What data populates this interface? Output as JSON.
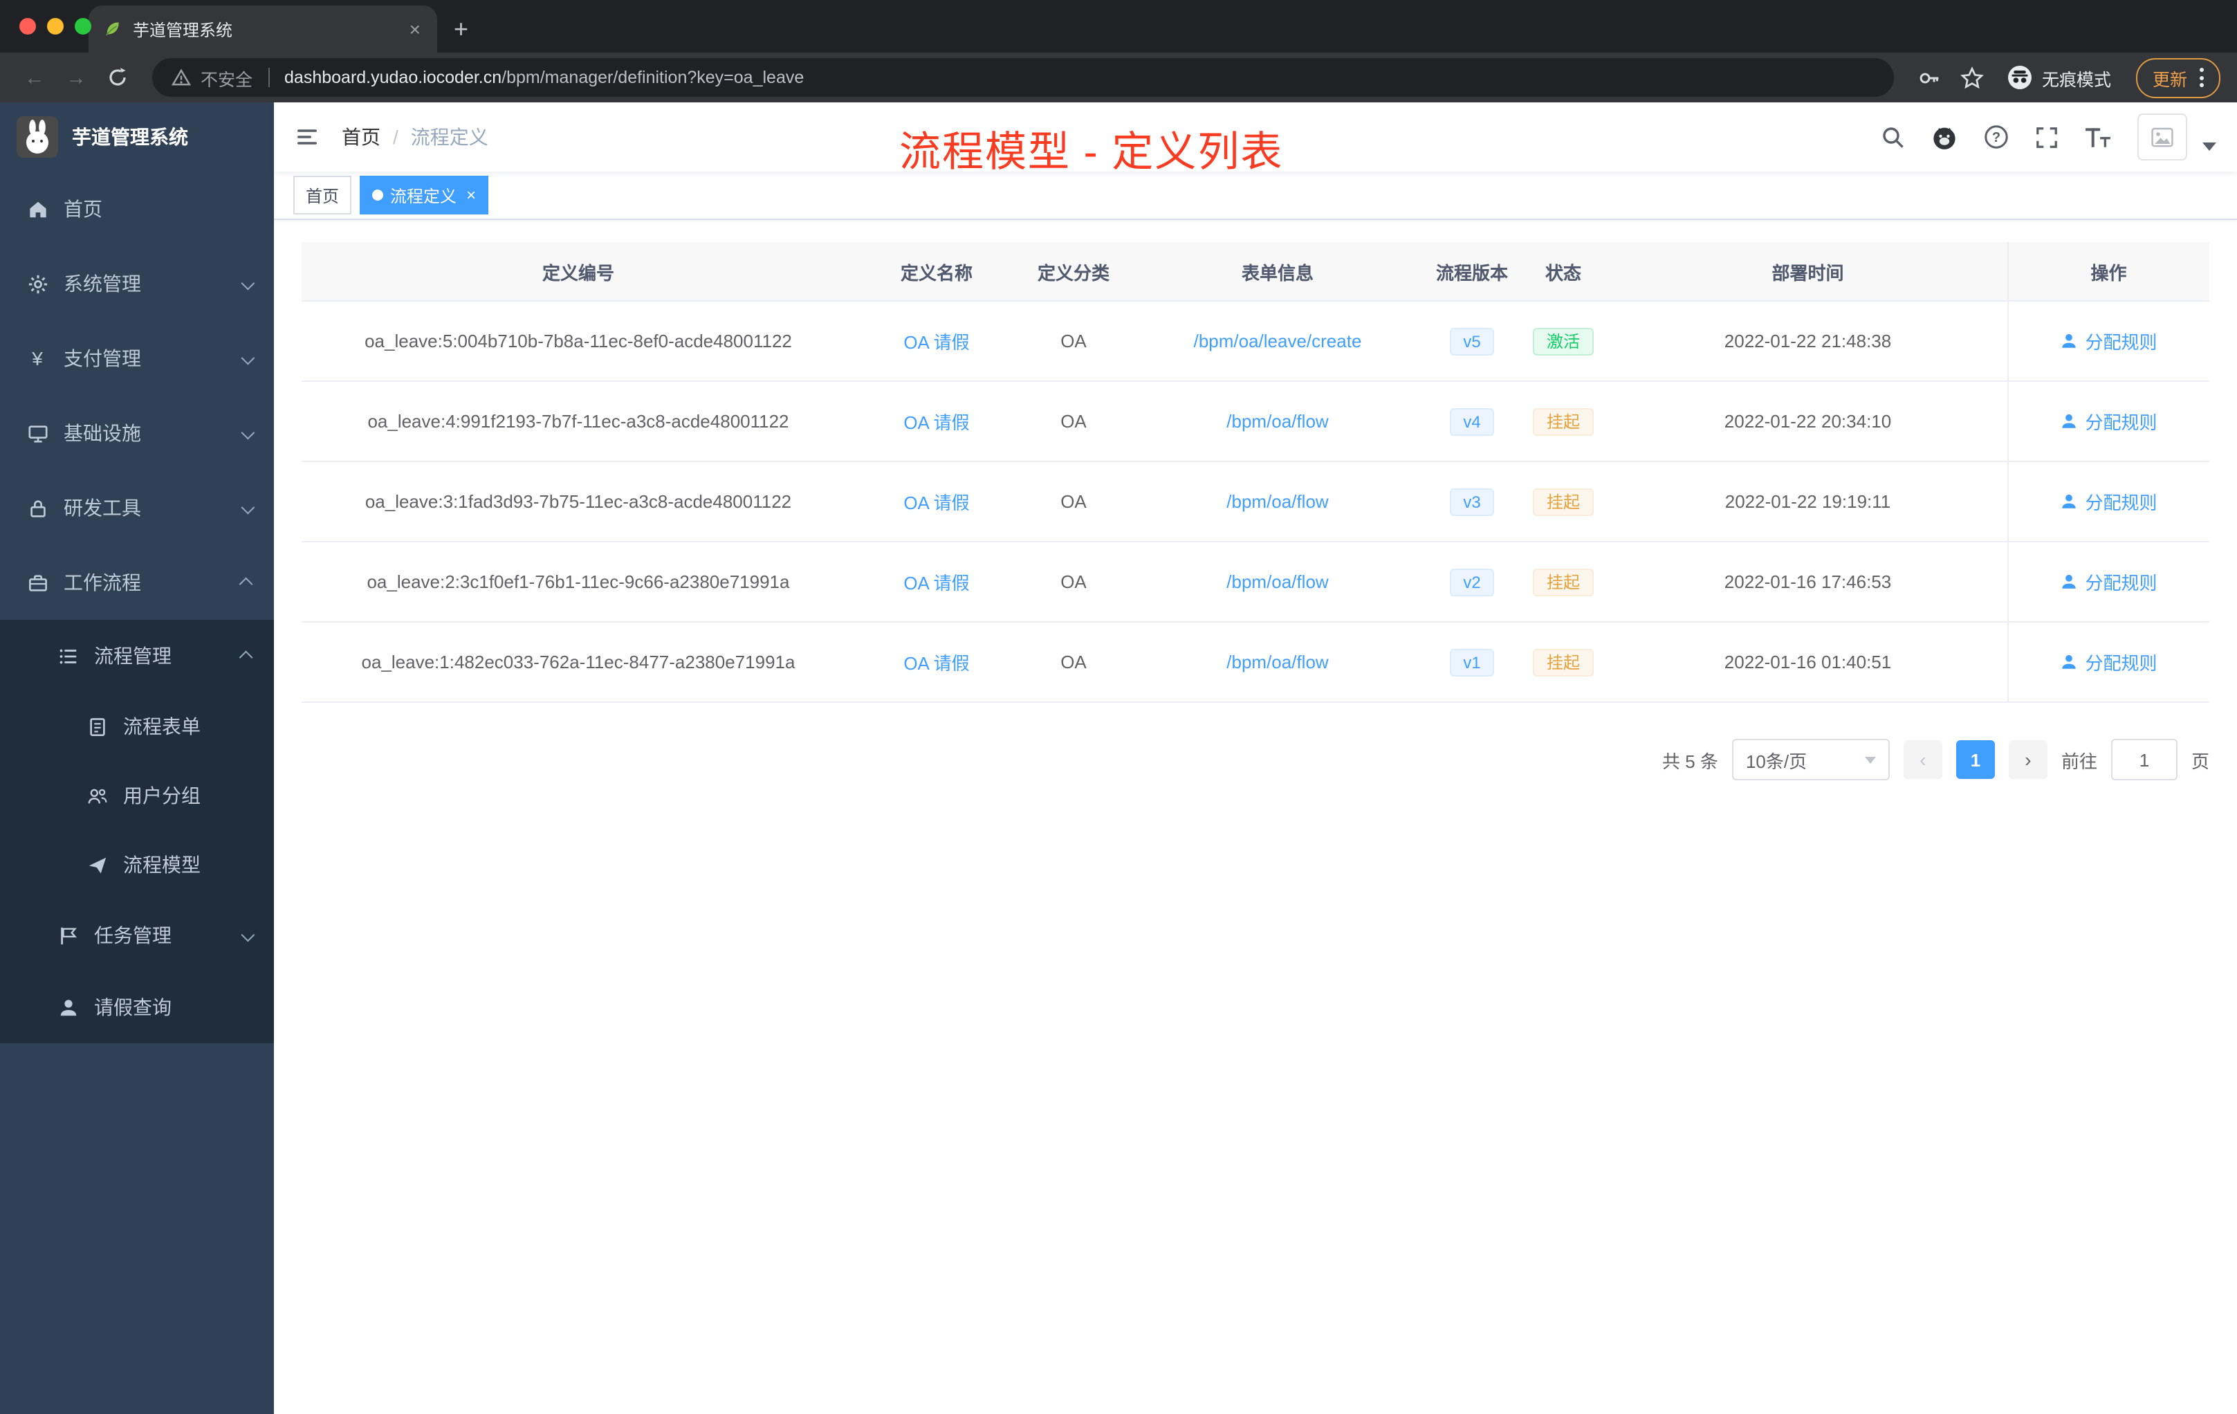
{
  "colors": {
    "accent": "#409eff",
    "success": "#13ce66",
    "warning": "#e6a23c",
    "annotation_red": "#f93b22",
    "sidebar_bg": "#304156",
    "submenu_bg": "#1f2d3d"
  },
  "browser": {
    "tab_title": "芋道管理系统",
    "new_tab_label": "+",
    "back_glyph": "←",
    "forward_glyph": "→",
    "security_label": "不安全",
    "url_host": "dashboard.yudao.iocoder.cn",
    "url_path": "/bpm/manager/definition?key=oa_leave",
    "incognito_label": "无痕模式",
    "update_label": "更新"
  },
  "sidebar": {
    "logo_title": "芋道管理系统",
    "menu": [
      {
        "label": "首页"
      },
      {
        "label": "系统管理"
      },
      {
        "label": "支付管理"
      },
      {
        "label": "基础设施"
      },
      {
        "label": "研发工具"
      },
      {
        "label": "工作流程"
      }
    ],
    "workflow": {
      "process_mgmt": {
        "label": "流程管理",
        "children": [
          {
            "label": "流程表单"
          },
          {
            "label": "用户分组"
          },
          {
            "label": "流程模型"
          }
        ]
      },
      "task_mgmt": {
        "label": "任务管理"
      },
      "leave_query": {
        "label": "请假查询"
      }
    }
  },
  "header": {
    "breadcrumb_home": "首页",
    "breadcrumb_separator": "/",
    "breadcrumb_current": "流程定义",
    "annotation": "流程模型 - 定义列表"
  },
  "tags": {
    "home": "首页",
    "active": "流程定义",
    "close_glyph": "×"
  },
  "table": {
    "columns": [
      "定义编号",
      "定义名称",
      "定义分类",
      "表单信息",
      "流程版本",
      "状态",
      "部署时间",
      "操作"
    ],
    "rows": [
      {
        "id": "oa_leave:5:004b710b-7b8a-11ec-8ef0-acde48001122",
        "name": "OA 请假",
        "category": "OA",
        "form": "/bpm/oa/leave/create",
        "version": "v5",
        "status": "激活",
        "status_type": "success",
        "deploy_time": "2022-01-22 21:48:38",
        "action": "分配规则"
      },
      {
        "id": "oa_leave:4:991f2193-7b7f-11ec-a3c8-acde48001122",
        "name": "OA 请假",
        "category": "OA",
        "form": "/bpm/oa/flow",
        "version": "v4",
        "status": "挂起",
        "status_type": "warning",
        "deploy_time": "2022-01-22 20:34:10",
        "action": "分配规则"
      },
      {
        "id": "oa_leave:3:1fad3d93-7b75-11ec-a3c8-acde48001122",
        "name": "OA 请假",
        "category": "OA",
        "form": "/bpm/oa/flow",
        "version": "v3",
        "status": "挂起",
        "status_type": "warning",
        "deploy_time": "2022-01-22 19:19:11",
        "action": "分配规则"
      },
      {
        "id": "oa_leave:2:3c1f0ef1-76b1-11ec-9c66-a2380e71991a",
        "name": "OA 请假",
        "category": "OA",
        "form": "/bpm/oa/flow",
        "version": "v2",
        "status": "挂起",
        "status_type": "warning",
        "deploy_time": "2022-01-16 17:46:53",
        "action": "分配规则"
      },
      {
        "id": "oa_leave:1:482ec033-762a-11ec-8477-a2380e71991a",
        "name": "OA 请假",
        "category": "OA",
        "form": "/bpm/oa/flow",
        "version": "v1",
        "status": "挂起",
        "status_type": "warning",
        "deploy_time": "2022-01-16 01:40:51",
        "action": "分配规则"
      }
    ]
  },
  "pagination": {
    "total_text": "共 5 条",
    "page_size_text": "10条/页",
    "prev_glyph": "‹",
    "next_glyph": "›",
    "current_page": "1",
    "goto_text": "前往",
    "goto_value": "1",
    "unit_text": "页"
  },
  "icons": {
    "tab_favicon": "leaf-icon",
    "address_security": "warning-triangle-icon",
    "toolbar_right": [
      "key-icon",
      "star-icon",
      "incognito-icon",
      "more-vert-icon"
    ],
    "navbar_right": [
      "search-icon",
      "github-icon",
      "help-icon",
      "fullscreen-icon",
      "font-size-icon"
    ],
    "row_action_icon": "user-icon"
  }
}
